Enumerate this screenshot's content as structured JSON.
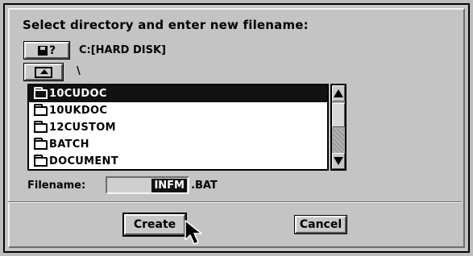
{
  "dialog": {
    "title": "Select directory and enter new filename:"
  },
  "drive": {
    "button_label": "?",
    "icon": "disk-icon",
    "current": "C:[HARD DISK]"
  },
  "path": {
    "up_icon": "folder-up-icon",
    "current": "\\"
  },
  "directory_list": {
    "items": [
      {
        "label": "10CUDOC",
        "selected": true,
        "icon": "folder-icon"
      },
      {
        "label": "10UKDOC",
        "selected": false,
        "icon": "folder-icon"
      },
      {
        "label": "12CUSTOM",
        "selected": false,
        "icon": "folder-icon"
      },
      {
        "label": "BATCH",
        "selected": false,
        "icon": "folder-icon"
      },
      {
        "label": "DOCUMENT",
        "selected": false,
        "icon": "folder-icon"
      }
    ]
  },
  "filename": {
    "label": "Filename:",
    "value": "INFM",
    "extension": ".BAT"
  },
  "buttons": {
    "create": "Create",
    "cancel": "Cancel"
  }
}
